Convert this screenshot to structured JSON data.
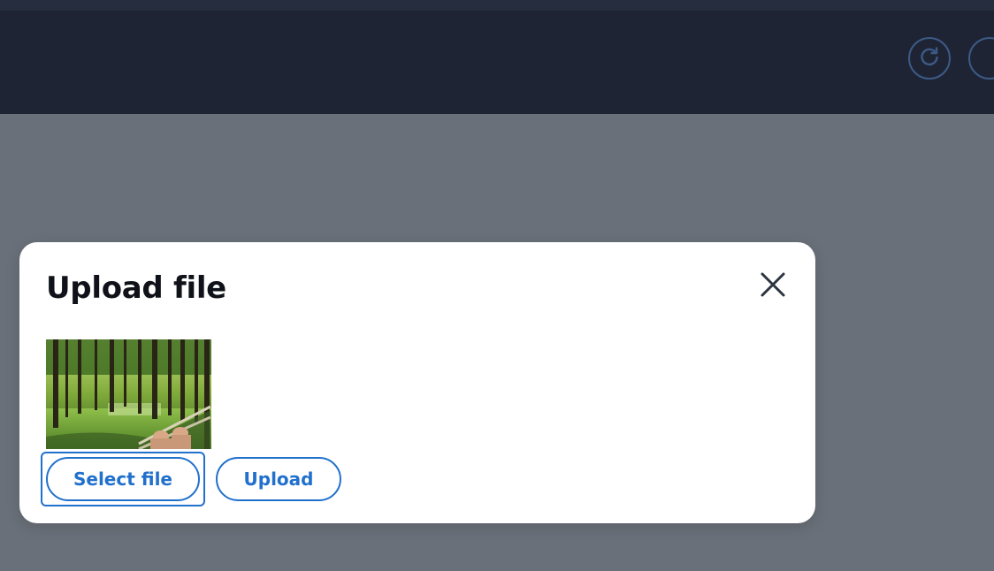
{
  "header": {
    "actions": [
      {
        "icon": "refresh-icon"
      },
      {
        "icon": "user-icon"
      }
    ]
  },
  "dialog": {
    "title": "Upload file",
    "close_icon": "close-icon",
    "preview": {
      "description_icon": "image-preview"
    },
    "buttons": {
      "select_label": "Select file",
      "upload_label": "Upload"
    }
  },
  "colors": {
    "header_bg": "#1e2433",
    "overlay": "#6a7079",
    "accent": "#2170cc",
    "icon_ring": "#3c5a86",
    "title_text": "#0f1319"
  }
}
